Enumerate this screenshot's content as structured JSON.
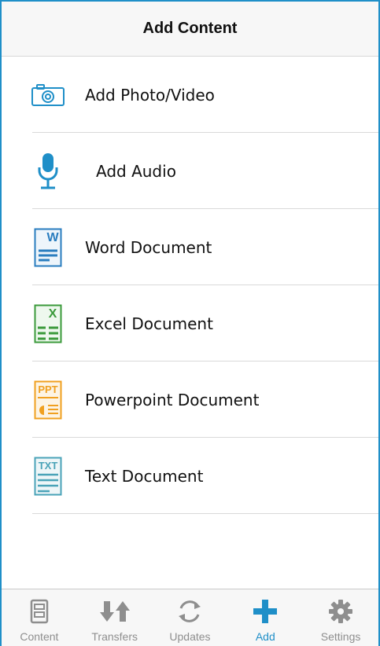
{
  "header": {
    "title": "Add Content"
  },
  "items": [
    {
      "label": "Add Photo/Video",
      "icon": "camera-icon"
    },
    {
      "label": "Add Audio",
      "icon": "microphone-icon"
    },
    {
      "label": "Word Document",
      "icon": "word-document-icon",
      "badge": "W"
    },
    {
      "label": "Excel Document",
      "icon": "excel-document-icon",
      "badge": "X"
    },
    {
      "label": "Powerpoint Document",
      "icon": "powerpoint-document-icon",
      "badge": "PPT"
    },
    {
      "label": "Text Document",
      "icon": "text-document-icon",
      "badge": "TXT"
    }
  ],
  "tabs": [
    {
      "label": "Content",
      "icon": "content-icon",
      "active": false
    },
    {
      "label": "Transfers",
      "icon": "transfers-icon",
      "active": false
    },
    {
      "label": "Updates",
      "icon": "updates-icon",
      "active": false
    },
    {
      "label": "Add",
      "icon": "plus-icon",
      "active": true
    },
    {
      "label": "Settings",
      "icon": "gear-icon",
      "active": false
    }
  ],
  "colors": {
    "accent": "#1f8fc8",
    "word": "#2a7dbf",
    "excel": "#3b9a3b",
    "powerpoint": "#f0a020",
    "text": "#4aa3b8",
    "tab_inactive": "#8e8e8e"
  }
}
